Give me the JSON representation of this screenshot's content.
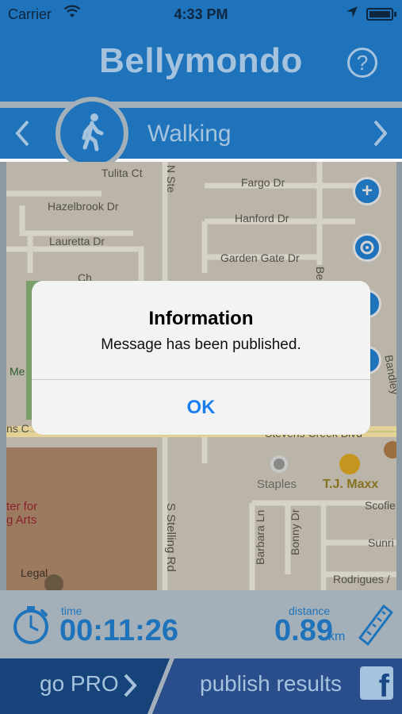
{
  "status_bar": {
    "carrier": "Carrier",
    "time": "4:33 PM"
  },
  "header": {
    "title": "Bellymondo",
    "help_icon": "question-circle-icon"
  },
  "mode_selector": {
    "mode_label": "Walking",
    "mode_icon": "walking-person-icon",
    "prev_icon": "chevron-left-icon",
    "next_icon": "chevron-right-icon"
  },
  "map": {
    "streets": {
      "tulita": "Tulita Ct",
      "n_ste": "N Ste",
      "fargo": "Fargo Dr",
      "hazelbrook": "Hazelbrook Dr",
      "hanford": "Hanford Dr",
      "lauretta": "Lauretta Dr",
      "garden_gate": "Garden Gate Dr",
      "stevens_creek": "Stevens Creek Blvd",
      "s_stelling": "S Stelling Rd",
      "barbara": "Barbara Ln",
      "bonny": "Bonny Dr",
      "scofield": "Scofie",
      "sunrise": "Sunri",
      "rodrigues": "Rodrigues /",
      "bandley": "Bandley",
      "left_edge_ns": "ns C",
      "left_edge_me": "Me",
      "ch": "Ch",
      "be": "Be"
    },
    "places": {
      "staples": "Staples",
      "tj_maxx": "T.J. Maxx",
      "center_line1": "ter for",
      "center_line2": "g Arts",
      "legal": "Legal"
    },
    "colors": {
      "land": "#bfb9ad",
      "road": "#dcd7cd",
      "park": "#7da36d",
      "lot": "#a07d62"
    }
  },
  "stats": {
    "time_label": "time",
    "time_value": "00:11:26",
    "distance_label": "distance",
    "distance_value": "0.89",
    "distance_unit": "km",
    "timer_icon": "stopwatch-icon",
    "ruler_icon": "ruler-icon"
  },
  "bottom_bar": {
    "go_pro_label": "go PRO",
    "publish_label": "publish results",
    "facebook_icon": "facebook-icon"
  },
  "alert": {
    "title": "Information",
    "message": "Message has been published.",
    "ok_label": "OK"
  },
  "colors": {
    "primary_blue": "#1f76bf",
    "dark_blue": "#17457c",
    "light_text": "#a9c7e2",
    "ok_blue": "#1a80f0"
  }
}
